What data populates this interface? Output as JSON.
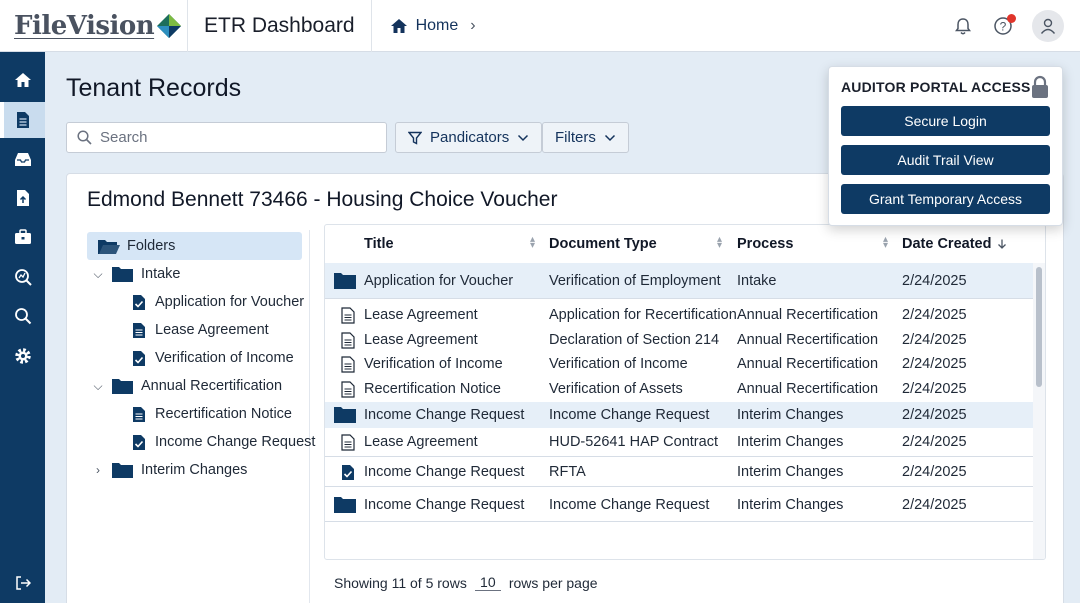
{
  "header": {
    "logo_text": "FileVision",
    "app_title": "ETR Dashboard",
    "breadcrumb_home": "Home"
  },
  "sidenav": {
    "items": [
      "home-icon",
      "document-icon",
      "inbox-icon",
      "file-upload-icon",
      "briefcase-icon",
      "analytics-search-icon",
      "search-icon",
      "gear-icon"
    ],
    "active_index": 1,
    "logout_icon": "logout-icon"
  },
  "page": {
    "title": "Tenant Records",
    "search_placeholder": "Search",
    "pandicators_label": "Pandicators",
    "filters_label": "Filters"
  },
  "record": {
    "title": "Edmond Bennett 73466 - Housing Choice Voucher"
  },
  "tree": {
    "root": "Folders",
    "nodes": [
      {
        "label": "Intake",
        "children": [
          {
            "label": "Application for Voucher",
            "icon": "doc-check-icon"
          },
          {
            "label": "Lease Agreement",
            "icon": "doc-lines-icon"
          },
          {
            "label": "Verification of Income",
            "icon": "doc-check-icon"
          }
        ]
      },
      {
        "label": "Annual Recertification",
        "children": [
          {
            "label": "Recertification Notice",
            "icon": "doc-lines-icon"
          },
          {
            "label": "Income Change Request",
            "icon": "doc-check-icon"
          }
        ]
      },
      {
        "label": "Interim Changes",
        "children": []
      }
    ]
  },
  "table": {
    "headers": {
      "title": "Title",
      "doc_type": "Document Type",
      "process": "Process",
      "date": "Date Created"
    },
    "rows": [
      {
        "icon": "folder",
        "title": "Application for Voucher",
        "doc_type": "Verification of Employment",
        "process": "Intake",
        "date": "2/24/2025"
      },
      {
        "icon": "doc",
        "title": "Lease Agreement",
        "doc_type": "Application for Recertification",
        "process": "Annual Recertification",
        "date": "2/24/2025"
      },
      {
        "icon": "doc",
        "title": "Lease Agreement",
        "doc_type": "Declaration of Section 214",
        "process": "Annual Recertification",
        "date": "2/24/2025"
      },
      {
        "icon": "doc",
        "title": "Verification of Income",
        "doc_type": "Verification of Income",
        "process": "Annual Recertification",
        "date": "2/24/2025"
      },
      {
        "icon": "doc",
        "title": "Recertification Notice",
        "doc_type": "Verification of Assets",
        "process": "Annual Recertification",
        "date": "2/24/2025"
      },
      {
        "icon": "folder",
        "title": "Income Change Request",
        "doc_type": "Income Change Request",
        "process": "Interim Changes",
        "date": "2/24/2025"
      },
      {
        "icon": "doc",
        "title": "Lease Agreement",
        "doc_type": "HUD-52641 HAP Contract",
        "process": "Interim Changes",
        "date": "2/24/2025"
      },
      {
        "icon": "doc-check",
        "title": "Income Change Request",
        "doc_type": "RFTA",
        "process": "Interim Changes",
        "date": "2/24/2025"
      },
      {
        "icon": "folder",
        "title": "Income Change Request",
        "doc_type": "Income Change Request",
        "process": "Interim Changes",
        "date": "2/24/2025"
      }
    ],
    "pager": {
      "showing": "Showing 11 of 5 rows",
      "rows_per_page": "10",
      "rows_per_page_label": "rows per page"
    }
  },
  "auditor": {
    "title": "AUDITOR PORTAL ACCESS",
    "buttons": [
      "Secure Login",
      "Audit Trail View",
      "Grant Temporary Access"
    ]
  },
  "colors": {
    "navy": "#0e3a64",
    "page_bg": "#e3ecf5",
    "highlight": "#e6eff8",
    "notify": "#e0352b"
  }
}
